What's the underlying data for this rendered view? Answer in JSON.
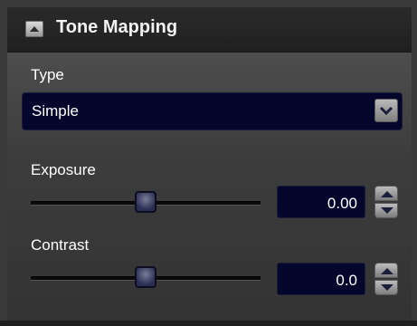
{
  "panel": {
    "title": "Tone Mapping",
    "collapse_icon": "caret-up-icon"
  },
  "type_field": {
    "label": "Type",
    "selected": "Simple",
    "dropdown_icon": "chevron-down-icon"
  },
  "exposure": {
    "label": "Exposure",
    "value": "0.00",
    "slider_level": 0.5
  },
  "contrast": {
    "label": "Contrast",
    "value": "0.0",
    "slider_level": 0.5
  },
  "colors": {
    "field_bg": "#04072b",
    "panel_bg": "#3c3c3c",
    "header_bg": "#202020"
  }
}
